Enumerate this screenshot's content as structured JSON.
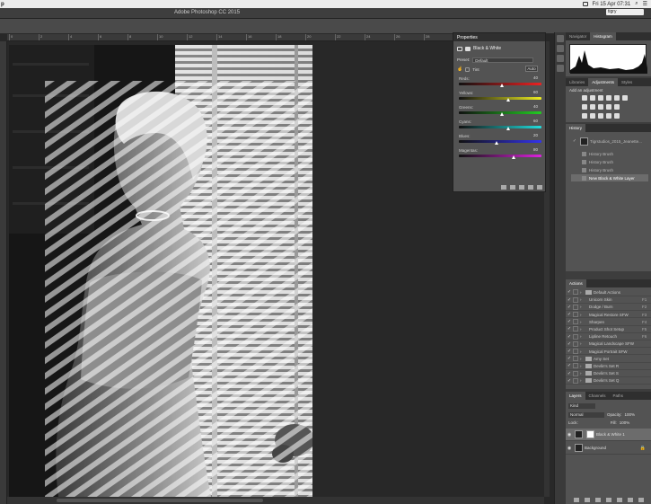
{
  "menubar": {
    "app_fragment": "p",
    "clock": "Fri 15 Apr  07:31"
  },
  "titlebar": {
    "title": "Adobe Photoshop CC 2015",
    "workspace": "tigry"
  },
  "properties": {
    "tab": "Properties",
    "title": "Black & White",
    "preset_label": "Preset:",
    "preset_value": "Default",
    "tint_label": "Tint",
    "auto_label": "Auto",
    "sliders": [
      {
        "label": "Reds:",
        "value": "40",
        "fraction": 0.53,
        "gradient": "linear-gradient(90deg,#111,#e22)"
      },
      {
        "label": "Yellows:",
        "value": "60",
        "fraction": 0.6,
        "gradient": "linear-gradient(90deg,#111,#ee2)"
      },
      {
        "label": "Greens:",
        "value": "40",
        "fraction": 0.53,
        "gradient": "linear-gradient(90deg,#111,#2c2)"
      },
      {
        "label": "Cyans:",
        "value": "60",
        "fraction": 0.6,
        "gradient": "linear-gradient(90deg,#111,#2dd)"
      },
      {
        "label": "Blues:",
        "value": "20",
        "fraction": 0.46,
        "gradient": "linear-gradient(90deg,#111,#33e)"
      },
      {
        "label": "Magentas:",
        "value": "80",
        "fraction": 0.67,
        "gradient": "linear-gradient(90deg,#111,#d2d)"
      }
    ]
  },
  "panels": {
    "nav_tabs": [
      "Navigator",
      "Histogram"
    ],
    "adj_tabs": [
      "Libraries",
      "Adjustments",
      "Styles"
    ],
    "adj_hint": "Add an adjustment",
    "history_tab": "History",
    "history_snapshot": "Tigrstudios_2015_Jeanette...",
    "history_items": [
      "History Brush",
      "History Brush",
      "History Brush",
      "New Black & White Layer"
    ],
    "actions_tab": "Actions",
    "actions": [
      {
        "name": "Default Actions",
        "key": "",
        "folder": true
      },
      {
        "name": "Unicorn Skin",
        "key": "F1",
        "folder": false
      },
      {
        "name": "Dodge / Burn",
        "key": "F2",
        "folder": false
      },
      {
        "name": "Magical Restore SFW",
        "key": "F3",
        "folder": false
      },
      {
        "name": "Sharpen",
        "key": "F4",
        "folder": false
      },
      {
        "name": "Product Shot Setup",
        "key": "F5",
        "folder": false
      },
      {
        "name": "Lipline Retouch",
        "key": "F6",
        "folder": false
      },
      {
        "name": "Magical Landscape SFW",
        "key": "",
        "folder": false
      },
      {
        "name": "Magical Portrait SFW",
        "key": "",
        "folder": false
      },
      {
        "name": "Amy Set",
        "key": "",
        "folder": true
      },
      {
        "name": "Devlin's Set R",
        "key": "",
        "folder": true
      },
      {
        "name": "Devlin's Set S",
        "key": "",
        "folder": true
      },
      {
        "name": "Devlin's Set Q",
        "key": "",
        "folder": true
      }
    ],
    "layers_tabs": [
      "Layers",
      "Channels",
      "Paths"
    ],
    "kind_label": "Kind",
    "blend_mode": "Normal",
    "opacity_label": "Opacity:",
    "opacity_value": "100%",
    "lock_label": "Lock:",
    "fill_label": "Fill:",
    "fill_value": "100%",
    "layers": [
      {
        "name": "Black & White 1",
        "selected": true
      },
      {
        "name": "Background",
        "selected": false
      }
    ]
  },
  "ruler": [
    "0",
    "2",
    "4",
    "6",
    "8",
    "10",
    "12",
    "14",
    "16",
    "18",
    "20",
    "22",
    "24",
    "26",
    "28",
    "30",
    "32",
    "34"
  ]
}
